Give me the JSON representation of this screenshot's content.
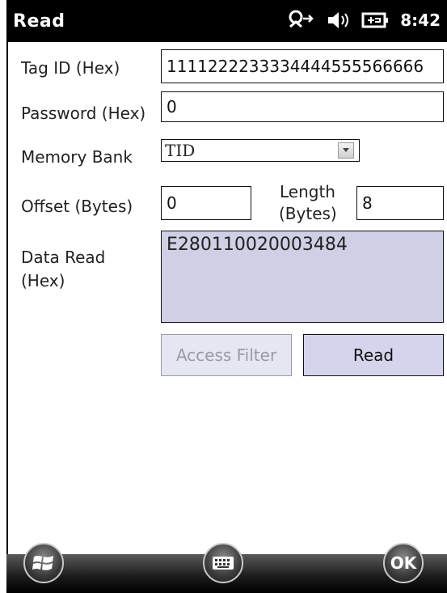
{
  "window": {
    "title": "Read"
  },
  "status": {
    "time": "8:42"
  },
  "form": {
    "tag_id_label": "Tag ID (Hex)",
    "tag_id_value": "1111222233334444555566666",
    "password_label": "Password (Hex)",
    "password_value": "0",
    "memory_bank_label": "Memory Bank",
    "memory_bank_value": "TID",
    "offset_label": "Offset (Bytes)",
    "offset_value": "0",
    "length_label_line1": "Length",
    "length_label_line2": "(Bytes)",
    "length_value": "8",
    "data_read_label_line1": "Data Read",
    "data_read_label_line2": "(Hex)",
    "data_read_value": "E280110020003484"
  },
  "buttons": {
    "access_filter": "Access Filter",
    "read": "Read"
  },
  "taskbar": {
    "ok": "OK"
  },
  "icons": {
    "connectivity": "connectivity-icon",
    "volume": "volume-icon",
    "battery": "battery-icon",
    "dropdown": "chevron-down-icon",
    "start": "windows-start-icon",
    "keyboard": "keyboard-icon"
  }
}
